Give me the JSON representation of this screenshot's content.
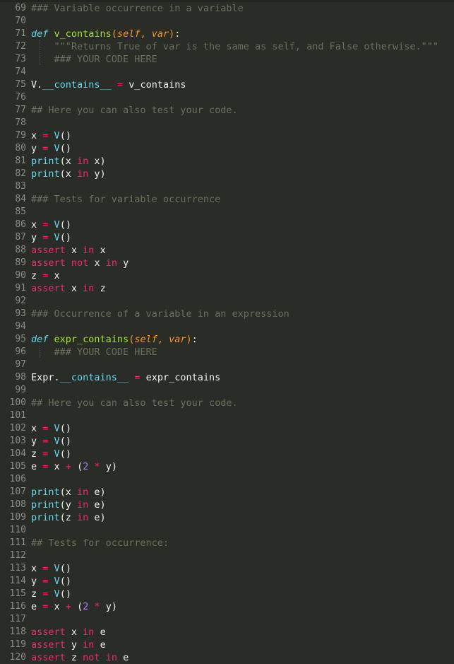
{
  "editor": {
    "language": "python",
    "theme": "monokai-dark",
    "background": "#2a2c27",
    "gutter_color": "#8a8f85",
    "first_line": 69,
    "last_line": 120,
    "colors": {
      "comment": "#6b705c",
      "keyword": "#f92672",
      "operator": "#f92672",
      "def_keyword": "#66d9ef",
      "function_name": "#a6e22e",
      "parameter": "#fd971f",
      "class_name": "#66d9ef",
      "builtin": "#66d9ef",
      "number": "#ae81ff",
      "plain_text": "#f2f2ec"
    }
  },
  "lines": [
    {
      "n": "69",
      "indent": false,
      "tokens": [
        {
          "t": "### Variable occurrence in a variable",
          "c": "c"
        }
      ]
    },
    {
      "n": "70",
      "indent": false,
      "tokens": []
    },
    {
      "n": "71",
      "indent": false,
      "tokens": [
        {
          "t": "def",
          "c": "def"
        },
        {
          "t": " ",
          "c": "pl"
        },
        {
          "t": "v_contains",
          "c": "fn"
        },
        {
          "t": "(",
          "c": "pn"
        },
        {
          "t": "self",
          "c": "pa"
        },
        {
          "t": ",",
          "c": "pn"
        },
        {
          "t": " ",
          "c": "pl"
        },
        {
          "t": "var",
          "c": "pa"
        },
        {
          "t": ")",
          "c": "pn"
        },
        {
          "t": ":",
          "c": "pl"
        }
      ]
    },
    {
      "n": "72",
      "indent": true,
      "tokens": [
        {
          "t": "    \"\"\"Returns True of var is the same as self, and False otherwise.\"\"\"",
          "c": "c"
        }
      ]
    },
    {
      "n": "73",
      "indent": true,
      "tokens": [
        {
          "t": "    ### YOUR CODE HERE",
          "c": "c"
        }
      ]
    },
    {
      "n": "74",
      "indent": false,
      "tokens": []
    },
    {
      "n": "75",
      "indent": false,
      "tokens": [
        {
          "t": "V.",
          "c": "pl"
        },
        {
          "t": "__contains__",
          "c": "cls"
        },
        {
          "t": " ",
          "c": "pl"
        },
        {
          "t": "=",
          "c": "op"
        },
        {
          "t": " v_contains",
          "c": "pl"
        }
      ]
    },
    {
      "n": "76",
      "indent": false,
      "tokens": []
    },
    {
      "n": "77",
      "indent": false,
      "tokens": [
        {
          "t": "## Here you can also test your code.",
          "c": "c"
        }
      ]
    },
    {
      "n": "78",
      "indent": false,
      "tokens": []
    },
    {
      "n": "79",
      "indent": false,
      "tokens": [
        {
          "t": "x ",
          "c": "pl"
        },
        {
          "t": "=",
          "c": "op"
        },
        {
          "t": " ",
          "c": "pl"
        },
        {
          "t": "V",
          "c": "cls"
        },
        {
          "t": "()",
          "c": "pl"
        }
      ]
    },
    {
      "n": "80",
      "indent": false,
      "tokens": [
        {
          "t": "y ",
          "c": "pl"
        },
        {
          "t": "=",
          "c": "op"
        },
        {
          "t": " ",
          "c": "pl"
        },
        {
          "t": "V",
          "c": "cls"
        },
        {
          "t": "()",
          "c": "pl"
        }
      ]
    },
    {
      "n": "81",
      "indent": false,
      "tokens": [
        {
          "t": "print",
          "c": "bi"
        },
        {
          "t": "(x ",
          "c": "pl"
        },
        {
          "t": "in",
          "c": "kw"
        },
        {
          "t": " x)",
          "c": "pl"
        }
      ]
    },
    {
      "n": "82",
      "indent": false,
      "tokens": [
        {
          "t": "print",
          "c": "bi"
        },
        {
          "t": "(x ",
          "c": "pl"
        },
        {
          "t": "in",
          "c": "kw"
        },
        {
          "t": " y)",
          "c": "pl"
        }
      ]
    },
    {
      "n": "83",
      "indent": false,
      "tokens": []
    },
    {
      "n": "84",
      "indent": false,
      "tokens": [
        {
          "t": "### Tests for variable occurrence",
          "c": "c"
        }
      ]
    },
    {
      "n": "85",
      "indent": false,
      "tokens": []
    },
    {
      "n": "86",
      "indent": false,
      "tokens": [
        {
          "t": "x ",
          "c": "pl"
        },
        {
          "t": "=",
          "c": "op"
        },
        {
          "t": " ",
          "c": "pl"
        },
        {
          "t": "V",
          "c": "cls"
        },
        {
          "t": "()",
          "c": "pl"
        }
      ]
    },
    {
      "n": "87",
      "indent": false,
      "tokens": [
        {
          "t": "y ",
          "c": "pl"
        },
        {
          "t": "=",
          "c": "op"
        },
        {
          "t": " ",
          "c": "pl"
        },
        {
          "t": "V",
          "c": "cls"
        },
        {
          "t": "()",
          "c": "pl"
        }
      ]
    },
    {
      "n": "88",
      "indent": false,
      "tokens": [
        {
          "t": "assert",
          "c": "kw"
        },
        {
          "t": " x ",
          "c": "pl"
        },
        {
          "t": "in",
          "c": "kw"
        },
        {
          "t": " x",
          "c": "pl"
        }
      ]
    },
    {
      "n": "89",
      "indent": false,
      "tokens": [
        {
          "t": "assert",
          "c": "kw"
        },
        {
          "t": " ",
          "c": "pl"
        },
        {
          "t": "not",
          "c": "kw"
        },
        {
          "t": " x ",
          "c": "pl"
        },
        {
          "t": "in",
          "c": "kw"
        },
        {
          "t": " y",
          "c": "pl"
        }
      ]
    },
    {
      "n": "90",
      "indent": false,
      "tokens": [
        {
          "t": "z ",
          "c": "pl"
        },
        {
          "t": "=",
          "c": "op"
        },
        {
          "t": " x",
          "c": "pl"
        }
      ]
    },
    {
      "n": "91",
      "indent": false,
      "tokens": [
        {
          "t": "assert",
          "c": "kw"
        },
        {
          "t": " x ",
          "c": "pl"
        },
        {
          "t": "in",
          "c": "kw"
        },
        {
          "t": " z",
          "c": "pl"
        }
      ]
    },
    {
      "n": "92",
      "indent": false,
      "tokens": []
    },
    {
      "n": "93",
      "indent": false,
      "tokens": [
        {
          "t": "### Occurrence of a variable in an expression",
          "c": "c"
        }
      ]
    },
    {
      "n": "94",
      "indent": false,
      "tokens": []
    },
    {
      "n": "95",
      "indent": false,
      "tokens": [
        {
          "t": "def",
          "c": "def"
        },
        {
          "t": " ",
          "c": "pl"
        },
        {
          "t": "expr_contains",
          "c": "fn"
        },
        {
          "t": "(",
          "c": "pn"
        },
        {
          "t": "self",
          "c": "pa"
        },
        {
          "t": ",",
          "c": "pn"
        },
        {
          "t": " ",
          "c": "pl"
        },
        {
          "t": "var",
          "c": "pa"
        },
        {
          "t": ")",
          "c": "pn"
        },
        {
          "t": ":",
          "c": "pl"
        }
      ]
    },
    {
      "n": "96",
      "indent": true,
      "tokens": [
        {
          "t": "    ### YOUR CODE HERE",
          "c": "c"
        }
      ]
    },
    {
      "n": "97",
      "indent": false,
      "tokens": []
    },
    {
      "n": "98",
      "indent": false,
      "tokens": [
        {
          "t": "Expr.",
          "c": "pl"
        },
        {
          "t": "__contains__",
          "c": "cls"
        },
        {
          "t": " ",
          "c": "pl"
        },
        {
          "t": "=",
          "c": "op"
        },
        {
          "t": " expr_contains",
          "c": "pl"
        }
      ]
    },
    {
      "n": "99",
      "indent": false,
      "tokens": []
    },
    {
      "n": "100",
      "indent": false,
      "tokens": [
        {
          "t": "## Here you can also test your code.",
          "c": "c"
        }
      ]
    },
    {
      "n": "101",
      "indent": false,
      "tokens": []
    },
    {
      "n": "102",
      "indent": false,
      "tokens": [
        {
          "t": "x ",
          "c": "pl"
        },
        {
          "t": "=",
          "c": "op"
        },
        {
          "t": " ",
          "c": "pl"
        },
        {
          "t": "V",
          "c": "cls"
        },
        {
          "t": "()",
          "c": "pl"
        }
      ]
    },
    {
      "n": "103",
      "indent": false,
      "tokens": [
        {
          "t": "y ",
          "c": "pl"
        },
        {
          "t": "=",
          "c": "op"
        },
        {
          "t": " ",
          "c": "pl"
        },
        {
          "t": "V",
          "c": "cls"
        },
        {
          "t": "()",
          "c": "pl"
        }
      ]
    },
    {
      "n": "104",
      "indent": false,
      "tokens": [
        {
          "t": "z ",
          "c": "pl"
        },
        {
          "t": "=",
          "c": "op"
        },
        {
          "t": " ",
          "c": "pl"
        },
        {
          "t": "V",
          "c": "cls"
        },
        {
          "t": "()",
          "c": "pl"
        }
      ]
    },
    {
      "n": "105",
      "indent": false,
      "tokens": [
        {
          "t": "e ",
          "c": "pl"
        },
        {
          "t": "=",
          "c": "op"
        },
        {
          "t": " x ",
          "c": "pl"
        },
        {
          "t": "+",
          "c": "op"
        },
        {
          "t": " (",
          "c": "pl"
        },
        {
          "t": "2",
          "c": "nu"
        },
        {
          "t": " ",
          "c": "pl"
        },
        {
          "t": "*",
          "c": "op"
        },
        {
          "t": " y)",
          "c": "pl"
        }
      ]
    },
    {
      "n": "106",
      "indent": false,
      "tokens": []
    },
    {
      "n": "107",
      "indent": false,
      "tokens": [
        {
          "t": "print",
          "c": "bi"
        },
        {
          "t": "(x ",
          "c": "pl"
        },
        {
          "t": "in",
          "c": "kw"
        },
        {
          "t": " e)",
          "c": "pl"
        }
      ]
    },
    {
      "n": "108",
      "indent": false,
      "tokens": [
        {
          "t": "print",
          "c": "bi"
        },
        {
          "t": "(y ",
          "c": "pl"
        },
        {
          "t": "in",
          "c": "kw"
        },
        {
          "t": " e)",
          "c": "pl"
        }
      ]
    },
    {
      "n": "109",
      "indent": false,
      "tokens": [
        {
          "t": "print",
          "c": "bi"
        },
        {
          "t": "(z ",
          "c": "pl"
        },
        {
          "t": "in",
          "c": "kw"
        },
        {
          "t": " e)",
          "c": "pl"
        }
      ]
    },
    {
      "n": "110",
      "indent": false,
      "tokens": []
    },
    {
      "n": "111",
      "indent": false,
      "tokens": [
        {
          "t": "## Tests for occurrence:",
          "c": "c"
        }
      ]
    },
    {
      "n": "112",
      "indent": false,
      "tokens": []
    },
    {
      "n": "113",
      "indent": false,
      "tokens": [
        {
          "t": "x ",
          "c": "pl"
        },
        {
          "t": "=",
          "c": "op"
        },
        {
          "t": " ",
          "c": "pl"
        },
        {
          "t": "V",
          "c": "cls"
        },
        {
          "t": "()",
          "c": "pl"
        }
      ]
    },
    {
      "n": "114",
      "indent": false,
      "tokens": [
        {
          "t": "y ",
          "c": "pl"
        },
        {
          "t": "=",
          "c": "op"
        },
        {
          "t": " ",
          "c": "pl"
        },
        {
          "t": "V",
          "c": "cls"
        },
        {
          "t": "()",
          "c": "pl"
        }
      ]
    },
    {
      "n": "115",
      "indent": false,
      "tokens": [
        {
          "t": "z ",
          "c": "pl"
        },
        {
          "t": "=",
          "c": "op"
        },
        {
          "t": " ",
          "c": "pl"
        },
        {
          "t": "V",
          "c": "cls"
        },
        {
          "t": "()",
          "c": "pl"
        }
      ]
    },
    {
      "n": "116",
      "indent": false,
      "tokens": [
        {
          "t": "e ",
          "c": "pl"
        },
        {
          "t": "=",
          "c": "op"
        },
        {
          "t": " x ",
          "c": "pl"
        },
        {
          "t": "+",
          "c": "op"
        },
        {
          "t": " (",
          "c": "pl"
        },
        {
          "t": "2",
          "c": "nu"
        },
        {
          "t": " ",
          "c": "pl"
        },
        {
          "t": "*",
          "c": "op"
        },
        {
          "t": " y)",
          "c": "pl"
        }
      ]
    },
    {
      "n": "117",
      "indent": false,
      "tokens": []
    },
    {
      "n": "118",
      "indent": false,
      "tokens": [
        {
          "t": "assert",
          "c": "kw"
        },
        {
          "t": " x ",
          "c": "pl"
        },
        {
          "t": "in",
          "c": "kw"
        },
        {
          "t": " e",
          "c": "pl"
        }
      ]
    },
    {
      "n": "119",
      "indent": false,
      "tokens": [
        {
          "t": "assert",
          "c": "kw"
        },
        {
          "t": " y ",
          "c": "pl"
        },
        {
          "t": "in",
          "c": "kw"
        },
        {
          "t": " e",
          "c": "pl"
        }
      ]
    },
    {
      "n": "120",
      "indent": false,
      "tokens": [
        {
          "t": "assert",
          "c": "kw"
        },
        {
          "t": " z ",
          "c": "pl"
        },
        {
          "t": "not",
          "c": "kw"
        },
        {
          "t": " ",
          "c": "pl"
        },
        {
          "t": "in",
          "c": "kw"
        },
        {
          "t": " e",
          "c": "pl"
        }
      ]
    }
  ]
}
